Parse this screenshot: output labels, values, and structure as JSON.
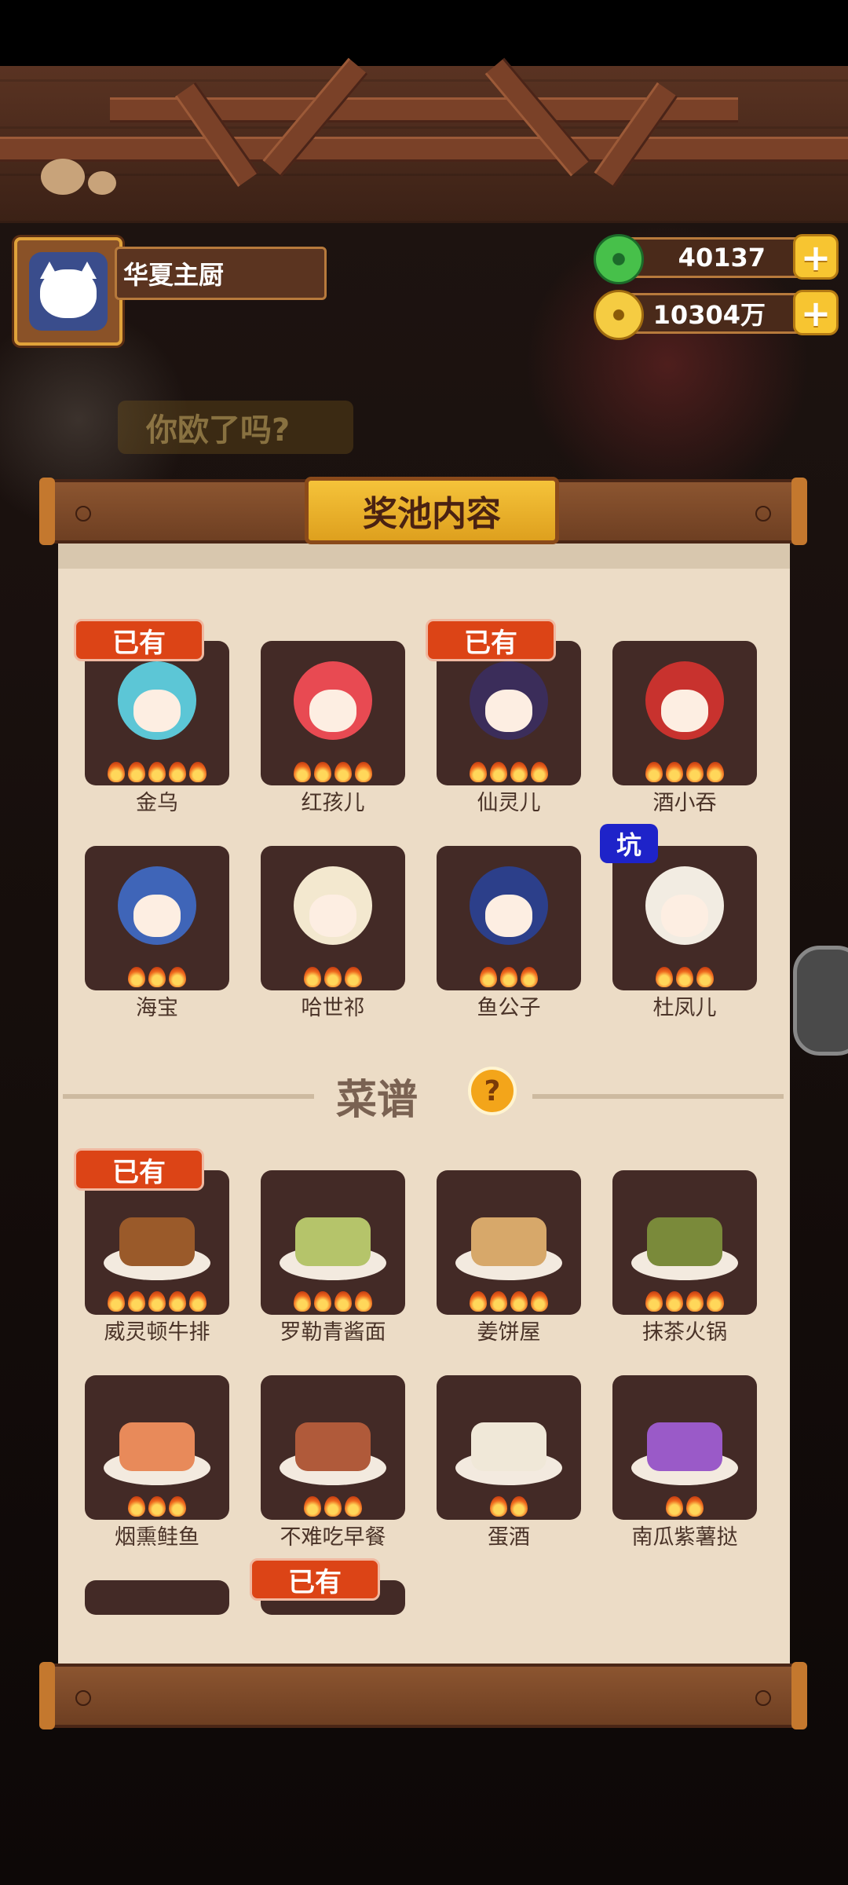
{
  "player": {
    "name": "华夏主厨"
  },
  "currency": {
    "jade": "40137",
    "coins": "10304万"
  },
  "background_banner": "你欧了吗?",
  "panel": {
    "title": "奖池内容"
  },
  "characters": [
    {
      "name": "金乌",
      "badge": "已有",
      "flames": 5,
      "hair": "#5cc6d6"
    },
    {
      "name": "红孩儿",
      "badge": "",
      "flames": 4,
      "hair": "#e84a52"
    },
    {
      "name": "仙灵儿",
      "badge": "已有",
      "flames": 4,
      "hair": "#3b2d5a"
    },
    {
      "name": "酒小吞",
      "badge": "",
      "flames": 4,
      "hair": "#c8322e"
    },
    {
      "name": "海宝",
      "badge": "",
      "flames": 3,
      "hair": "#3f65b8"
    },
    {
      "name": "哈世祁",
      "badge": "",
      "flames": 3,
      "hair": "#f3e8cf"
    },
    {
      "name": "鱼公子",
      "badge": "",
      "flames": 3,
      "hair": "#2c3f8a"
    },
    {
      "name": "杜凤儿",
      "badge": "坑",
      "badge_style": "pit",
      "flames": 3,
      "hair": "#f2ece2"
    }
  ],
  "recipes_section": {
    "title": "菜谱",
    "help_icon": "question-icon"
  },
  "recipes": [
    {
      "name": "威灵顿牛排",
      "badge": "已有",
      "flames": 5,
      "color": "#9a5a2a"
    },
    {
      "name": "罗勒青酱面",
      "badge": "",
      "flames": 4,
      "color": "#b5c46a"
    },
    {
      "name": "姜饼屋",
      "badge": "",
      "flames": 4,
      "color": "#d7a86a"
    },
    {
      "name": "抹茶火锅",
      "badge": "",
      "flames": 4,
      "color": "#7a8a3a"
    },
    {
      "name": "烟熏鲑鱼",
      "badge": "",
      "flames": 3,
      "color": "#e88a5a"
    },
    {
      "name": "不难吃早餐",
      "badge": "",
      "flames": 3,
      "color": "#b05a3a"
    },
    {
      "name": "蛋酒",
      "badge": "",
      "flames": 2,
      "color": "#f0e8d8"
    },
    {
      "name": "南瓜紫薯挞",
      "badge": "",
      "flames": 2,
      "color": "#9a5ac8"
    },
    {
      "name": "",
      "badge": "",
      "flames": 0,
      "color": "#432a26"
    },
    {
      "name": "",
      "badge": "已有",
      "flames": 0,
      "color": "#432a26"
    }
  ]
}
